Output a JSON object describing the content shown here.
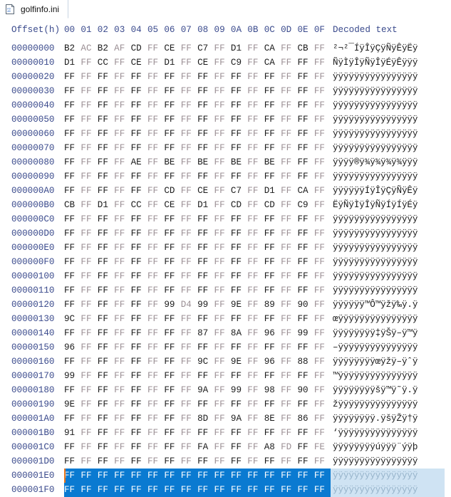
{
  "tab": {
    "label": "golfinfo.ini",
    "icon": "hex-file-icon",
    "icon_text_top": "FD",
    "icon_text_bottom": "A0"
  },
  "header": {
    "offset_label": "Offset(h)",
    "byte_columns": [
      "00",
      "01",
      "02",
      "03",
      "04",
      "05",
      "06",
      "07",
      "08",
      "09",
      "0A",
      "0B",
      "0C",
      "0D",
      "0E",
      "0F"
    ],
    "ascii_label": "Decoded text"
  },
  "selection": {
    "selected_offsets": [
      "000001E0",
      "000001F0"
    ],
    "highlight_color": "#0a7ad1",
    "ascii_highlight_color": "#cfe3f3",
    "caret_color": "#e8761c"
  },
  "colors": {
    "offset_text": "#3a4a8c",
    "byte_even": "#1b1b1b",
    "byte_odd": "#9b8f94",
    "background": "#ffffff"
  },
  "rows": [
    {
      "offset": "00000000",
      "bytes": [
        "B2",
        "AC",
        "B2",
        "AF",
        "CD",
        "FF",
        "CE",
        "FF",
        "C7",
        "FF",
        "D1",
        "FF",
        "CA",
        "FF",
        "CB",
        "FF"
      ],
      "ascii": "²¬²¯ÍÿÎÿÇÿÑÿÊÿËÿ"
    },
    {
      "offset": "00000010",
      "bytes": [
        "D1",
        "FF",
        "CC",
        "FF",
        "CE",
        "FF",
        "D1",
        "FF",
        "CE",
        "FF",
        "C9",
        "FF",
        "CA",
        "FF",
        "FF",
        "FF"
      ],
      "ascii": "ÑÿÌÿÎÿÑÿÎÿÉÿÊÿÿÿ"
    },
    {
      "offset": "00000020",
      "bytes": [
        "FF",
        "FF",
        "FF",
        "FF",
        "FF",
        "FF",
        "FF",
        "FF",
        "FF",
        "FF",
        "FF",
        "FF",
        "FF",
        "FF",
        "FF",
        "FF"
      ],
      "ascii": "ÿÿÿÿÿÿÿÿÿÿÿÿÿÿÿÿ"
    },
    {
      "offset": "00000030",
      "bytes": [
        "FF",
        "FF",
        "FF",
        "FF",
        "FF",
        "FF",
        "FF",
        "FF",
        "FF",
        "FF",
        "FF",
        "FF",
        "FF",
        "FF",
        "FF",
        "FF"
      ],
      "ascii": "ÿÿÿÿÿÿÿÿÿÿÿÿÿÿÿÿ"
    },
    {
      "offset": "00000040",
      "bytes": [
        "FF",
        "FF",
        "FF",
        "FF",
        "FF",
        "FF",
        "FF",
        "FF",
        "FF",
        "FF",
        "FF",
        "FF",
        "FF",
        "FF",
        "FF",
        "FF"
      ],
      "ascii": "ÿÿÿÿÿÿÿÿÿÿÿÿÿÿÿÿ"
    },
    {
      "offset": "00000050",
      "bytes": [
        "FF",
        "FF",
        "FF",
        "FF",
        "FF",
        "FF",
        "FF",
        "FF",
        "FF",
        "FF",
        "FF",
        "FF",
        "FF",
        "FF",
        "FF",
        "FF"
      ],
      "ascii": "ÿÿÿÿÿÿÿÿÿÿÿÿÿÿÿÿ"
    },
    {
      "offset": "00000060",
      "bytes": [
        "FF",
        "FF",
        "FF",
        "FF",
        "FF",
        "FF",
        "FF",
        "FF",
        "FF",
        "FF",
        "FF",
        "FF",
        "FF",
        "FF",
        "FF",
        "FF"
      ],
      "ascii": "ÿÿÿÿÿÿÿÿÿÿÿÿÿÿÿÿ"
    },
    {
      "offset": "00000070",
      "bytes": [
        "FF",
        "FF",
        "FF",
        "FF",
        "FF",
        "FF",
        "FF",
        "FF",
        "FF",
        "FF",
        "FF",
        "FF",
        "FF",
        "FF",
        "FF",
        "FF"
      ],
      "ascii": "ÿÿÿÿÿÿÿÿÿÿÿÿÿÿÿÿ"
    },
    {
      "offset": "00000080",
      "bytes": [
        "FF",
        "FF",
        "FF",
        "FF",
        "AE",
        "FF",
        "BE",
        "FF",
        "BE",
        "FF",
        "BE",
        "FF",
        "BE",
        "FF",
        "FF",
        "FF"
      ],
      "ascii": "ÿÿÿÿ®ÿ¾ÿ¾ÿ¾ÿ¾ÿÿÿ"
    },
    {
      "offset": "00000090",
      "bytes": [
        "FF",
        "FF",
        "FF",
        "FF",
        "FF",
        "FF",
        "FF",
        "FF",
        "FF",
        "FF",
        "FF",
        "FF",
        "FF",
        "FF",
        "FF",
        "FF"
      ],
      "ascii": "ÿÿÿÿÿÿÿÿÿÿÿÿÿÿÿÿ"
    },
    {
      "offset": "000000A0",
      "bytes": [
        "FF",
        "FF",
        "FF",
        "FF",
        "FF",
        "FF",
        "CD",
        "FF",
        "CE",
        "FF",
        "C7",
        "FF",
        "D1",
        "FF",
        "CA",
        "FF"
      ],
      "ascii": "ÿÿÿÿÿÿÍÿÎÿÇÿÑÿÊÿ"
    },
    {
      "offset": "000000B0",
      "bytes": [
        "CB",
        "FF",
        "D1",
        "FF",
        "CC",
        "FF",
        "CE",
        "FF",
        "D1",
        "FF",
        "CD",
        "FF",
        "CD",
        "FF",
        "C9",
        "FF"
      ],
      "ascii": "ËÿÑÿÌÿÎÿÑÿÍÿÍÿÉÿ"
    },
    {
      "offset": "000000C0",
      "bytes": [
        "FF",
        "FF",
        "FF",
        "FF",
        "FF",
        "FF",
        "FF",
        "FF",
        "FF",
        "FF",
        "FF",
        "FF",
        "FF",
        "FF",
        "FF",
        "FF"
      ],
      "ascii": "ÿÿÿÿÿÿÿÿÿÿÿÿÿÿÿÿ"
    },
    {
      "offset": "000000D0",
      "bytes": [
        "FF",
        "FF",
        "FF",
        "FF",
        "FF",
        "FF",
        "FF",
        "FF",
        "FF",
        "FF",
        "FF",
        "FF",
        "FF",
        "FF",
        "FF",
        "FF"
      ],
      "ascii": "ÿÿÿÿÿÿÿÿÿÿÿÿÿÿÿÿ"
    },
    {
      "offset": "000000E0",
      "bytes": [
        "FF",
        "FF",
        "FF",
        "FF",
        "FF",
        "FF",
        "FF",
        "FF",
        "FF",
        "FF",
        "FF",
        "FF",
        "FF",
        "FF",
        "FF",
        "FF"
      ],
      "ascii": "ÿÿÿÿÿÿÿÿÿÿÿÿÿÿÿÿ"
    },
    {
      "offset": "000000F0",
      "bytes": [
        "FF",
        "FF",
        "FF",
        "FF",
        "FF",
        "FF",
        "FF",
        "FF",
        "FF",
        "FF",
        "FF",
        "FF",
        "FF",
        "FF",
        "FF",
        "FF"
      ],
      "ascii": "ÿÿÿÿÿÿÿÿÿÿÿÿÿÿÿÿ"
    },
    {
      "offset": "00000100",
      "bytes": [
        "FF",
        "FF",
        "FF",
        "FF",
        "FF",
        "FF",
        "FF",
        "FF",
        "FF",
        "FF",
        "FF",
        "FF",
        "FF",
        "FF",
        "FF",
        "FF"
      ],
      "ascii": "ÿÿÿÿÿÿÿÿÿÿÿÿÿÿÿÿ"
    },
    {
      "offset": "00000110",
      "bytes": [
        "FF",
        "FF",
        "FF",
        "FF",
        "FF",
        "FF",
        "FF",
        "FF",
        "FF",
        "FF",
        "FF",
        "FF",
        "FF",
        "FF",
        "FF",
        "FF"
      ],
      "ascii": "ÿÿÿÿÿÿÿÿÿÿÿÿÿÿÿÿ"
    },
    {
      "offset": "00000120",
      "bytes": [
        "FF",
        "FF",
        "FF",
        "FF",
        "FF",
        "FF",
        "99",
        "D4",
        "99",
        "FF",
        "9E",
        "FF",
        "89",
        "FF",
        "90",
        "FF"
      ],
      "ascii": "ÿÿÿÿÿÿ™Ô™ÿžÿ‰ÿ.ÿ"
    },
    {
      "offset": "00000130",
      "bytes": [
        "9C",
        "FF",
        "FF",
        "FF",
        "FF",
        "FF",
        "FF",
        "FF",
        "FF",
        "FF",
        "FF",
        "FF",
        "FF",
        "FF",
        "FF",
        "FF"
      ],
      "ascii": "œÿÿÿÿÿÿÿÿÿÿÿÿÿÿÿ"
    },
    {
      "offset": "00000140",
      "bytes": [
        "FF",
        "FF",
        "FF",
        "FF",
        "FF",
        "FF",
        "FF",
        "FF",
        "87",
        "FF",
        "8A",
        "FF",
        "96",
        "FF",
        "99",
        "FF"
      ],
      "ascii": "ÿÿÿÿÿÿÿÿ‡ÿŠÿ–ÿ™ÿ"
    },
    {
      "offset": "00000150",
      "bytes": [
        "96",
        "FF",
        "FF",
        "FF",
        "FF",
        "FF",
        "FF",
        "FF",
        "FF",
        "FF",
        "FF",
        "FF",
        "FF",
        "FF",
        "FF",
        "FF"
      ],
      "ascii": "–ÿÿÿÿÿÿÿÿÿÿÿÿÿÿÿ"
    },
    {
      "offset": "00000160",
      "bytes": [
        "FF",
        "FF",
        "FF",
        "FF",
        "FF",
        "FF",
        "FF",
        "FF",
        "9C",
        "FF",
        "9E",
        "FF",
        "96",
        "FF",
        "88",
        "FF"
      ],
      "ascii": "ÿÿÿÿÿÿÿÿœÿžÿ–ÿˆÿ"
    },
    {
      "offset": "00000170",
      "bytes": [
        "99",
        "FF",
        "FF",
        "FF",
        "FF",
        "FF",
        "FF",
        "FF",
        "FF",
        "FF",
        "FF",
        "FF",
        "FF",
        "FF",
        "FF",
        "FF"
      ],
      "ascii": "™ÿÿÿÿÿÿÿÿÿÿÿÿÿÿÿ"
    },
    {
      "offset": "00000180",
      "bytes": [
        "FF",
        "FF",
        "FF",
        "FF",
        "FF",
        "FF",
        "FF",
        "FF",
        "9A",
        "FF",
        "99",
        "FF",
        "98",
        "FF",
        "90",
        "FF"
      ],
      "ascii": "ÿÿÿÿÿÿÿÿšÿ™ÿ˜ÿ.ÿ"
    },
    {
      "offset": "00000190",
      "bytes": [
        "9E",
        "FF",
        "FF",
        "FF",
        "FF",
        "FF",
        "FF",
        "FF",
        "FF",
        "FF",
        "FF",
        "FF",
        "FF",
        "FF",
        "FF",
        "FF"
      ],
      "ascii": "žÿÿÿÿÿÿÿÿÿÿÿÿÿÿÿ"
    },
    {
      "offset": "000001A0",
      "bytes": [
        "FF",
        "FF",
        "FF",
        "FF",
        "FF",
        "FF",
        "FF",
        "FF",
        "8D",
        "FF",
        "9A",
        "FF",
        "8E",
        "FF",
        "86",
        "FF"
      ],
      "ascii": "ÿÿÿÿÿÿÿÿ.ÿšÿŽÿ†ÿ"
    },
    {
      "offset": "000001B0",
      "bytes": [
        "91",
        "FF",
        "FF",
        "FF",
        "FF",
        "FF",
        "FF",
        "FF",
        "FF",
        "FF",
        "FF",
        "FF",
        "FF",
        "FF",
        "FF",
        "FF"
      ],
      "ascii": "‘ÿÿÿÿÿÿÿÿÿÿÿÿÿÿÿ"
    },
    {
      "offset": "000001C0",
      "bytes": [
        "FF",
        "FF",
        "FF",
        "FF",
        "FF",
        "FF",
        "FF",
        "FF",
        "FA",
        "FF",
        "FF",
        "FF",
        "A8",
        "FD",
        "FF",
        "FE"
      ],
      "ascii": "ÿÿÿÿÿÿÿÿúÿÿÿ¨ýÿþ"
    },
    {
      "offset": "000001D0",
      "bytes": [
        "FF",
        "FF",
        "FF",
        "FF",
        "FF",
        "FF",
        "FF",
        "FF",
        "FF",
        "FF",
        "FF",
        "FF",
        "FF",
        "FF",
        "FF",
        "FF"
      ],
      "ascii": "ÿÿÿÿÿÿÿÿÿÿÿÿÿÿÿÿ"
    },
    {
      "offset": "000001E0",
      "bytes": [
        "FF",
        "FF",
        "FF",
        "FF",
        "FF",
        "FF",
        "FF",
        "FF",
        "FF",
        "FF",
        "FF",
        "FF",
        "FF",
        "FF",
        "FF",
        "FF"
      ],
      "ascii": "ÿÿÿÿÿÿÿÿÿÿÿÿÿÿÿÿ",
      "selected": true
    },
    {
      "offset": "000001F0",
      "bytes": [
        "FF",
        "FF",
        "FF",
        "FF",
        "FF",
        "FF",
        "FF",
        "FF",
        "FF",
        "FF",
        "FF",
        "FF",
        "FF",
        "FF",
        "FF",
        "FF"
      ],
      "ascii": "ÿÿÿÿÿÿÿÿÿÿÿÿÿÿÿÿ",
      "selected": true
    }
  ]
}
